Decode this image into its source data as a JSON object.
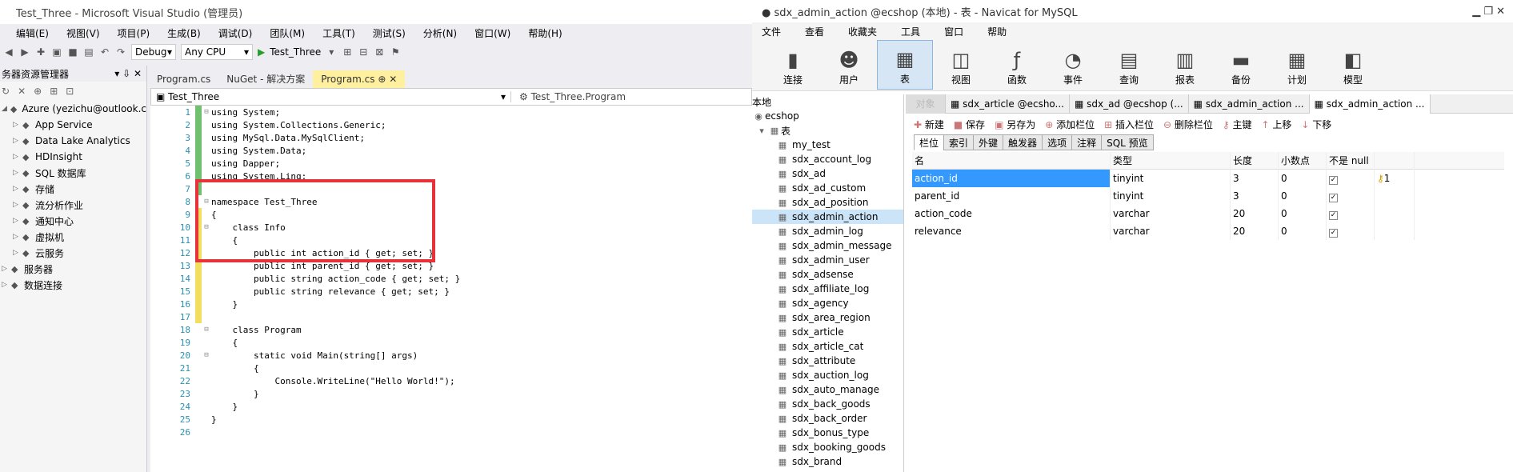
{
  "vs": {
    "title": "Test_Three - Microsoft Visual Studio (管理员)",
    "menu": [
      "编辑(E)",
      "视图(V)",
      "项目(P)",
      "生成(B)",
      "调试(D)",
      "团队(M)",
      "工具(T)",
      "测试(S)",
      "分析(N)",
      "窗口(W)",
      "帮助(H)"
    ],
    "config": "Debug",
    "platform": "Any CPU",
    "start_label": "Test_Three",
    "server_explorer": {
      "title": "务器资源管理器",
      "items": [
        {
          "label": "Azure (yezichu@outlook.c",
          "icon": "azure-icon",
          "level": 0
        },
        {
          "label": "App Service",
          "icon": "app-service-icon",
          "level": 1
        },
        {
          "label": "Data Lake Analytics",
          "icon": "data-lake-icon",
          "level": 1
        },
        {
          "label": "HDInsight",
          "icon": "hdinsight-icon",
          "level": 1
        },
        {
          "label": "SQL 数据库",
          "icon": "sql-db-icon",
          "level": 1
        },
        {
          "label": "存储",
          "icon": "storage-icon",
          "level": 1
        },
        {
          "label": "流分析作业",
          "icon": "stream-icon",
          "level": 1
        },
        {
          "label": "通知中心",
          "icon": "notification-icon",
          "level": 1
        },
        {
          "label": "虚拟机",
          "icon": "vm-icon",
          "level": 1
        },
        {
          "label": "云服务",
          "icon": "cloud-icon",
          "level": 1
        },
        {
          "label": "服务器",
          "icon": "server-icon",
          "level": 0
        },
        {
          "label": "数据连接",
          "icon": "data-connection-icon",
          "level": 0
        }
      ]
    },
    "tabs": [
      "Program.cs",
      "NuGet - 解决方案",
      "Program.cs"
    ],
    "nav_class": "Test_Three",
    "nav_member": "Test_Three.Program",
    "code": [
      {
        "n": "1",
        "t": "using System;"
      },
      {
        "n": "2",
        "t": "using System.Collections.Generic;"
      },
      {
        "n": "3",
        "t": "using MySql.Data.MySqlClient;"
      },
      {
        "n": "4",
        "t": "using System.Data;"
      },
      {
        "n": "5",
        "t": "using Dapper;"
      },
      {
        "n": "6",
        "t": "using System.Linq;"
      },
      {
        "n": "7",
        "t": ""
      },
      {
        "n": "8",
        "t": "namespace Test_Three"
      },
      {
        "n": "9",
        "t": "{"
      },
      {
        "n": "10",
        "t": "    class Info"
      },
      {
        "n": "11",
        "t": "    {"
      },
      {
        "n": "12",
        "t": "        public int action_id { get; set; }"
      },
      {
        "n": "13",
        "t": "        public int parent_id { get; set; }"
      },
      {
        "n": "14",
        "t": "        public string action_code { get; set; }"
      },
      {
        "n": "15",
        "t": "        public string relevance { get; set; }"
      },
      {
        "n": "16",
        "t": "    }"
      },
      {
        "n": "17",
        "t": ""
      },
      {
        "n": "18",
        "t": "    class Program"
      },
      {
        "n": "19",
        "t": "    {"
      },
      {
        "n": "20",
        "t": "        static void Main(string[] args)"
      },
      {
        "n": "21",
        "t": "        {"
      },
      {
        "n": "22",
        "t": "            Console.WriteLine(\"Hello World!\");"
      },
      {
        "n": "23",
        "t": "        }"
      },
      {
        "n": "24",
        "t": "    }"
      },
      {
        "n": "25",
        "t": "}"
      },
      {
        "n": "26",
        "t": ""
      }
    ]
  },
  "nv": {
    "title": "sdx_admin_action @ecshop (本地) - 表 - Navicat for MySQL",
    "menu": [
      "文件",
      "查看",
      "收藏夹",
      "工具",
      "窗口",
      "帮助"
    ],
    "toolbar": [
      {
        "label": "连接",
        "icon": "connection-icon"
      },
      {
        "label": "用户",
        "icon": "user-icon"
      },
      {
        "label": "表",
        "icon": "table-icon"
      },
      {
        "label": "视图",
        "icon": "view-icon"
      },
      {
        "label": "函数",
        "icon": "function-icon"
      },
      {
        "label": "事件",
        "icon": "event-icon"
      },
      {
        "label": "查询",
        "icon": "query-icon"
      },
      {
        "label": "报表",
        "icon": "report-icon"
      },
      {
        "label": "备份",
        "icon": "backup-icon"
      },
      {
        "label": "计划",
        "icon": "schedule-icon"
      },
      {
        "label": "模型",
        "icon": "model-icon"
      }
    ],
    "tree_root": "本地",
    "tree_db": "ecshop",
    "tree_group": "表",
    "tables": [
      "my_test",
      "sdx_account_log",
      "sdx_ad",
      "sdx_ad_custom",
      "sdx_ad_position",
      "sdx_admin_action",
      "sdx_admin_log",
      "sdx_admin_message",
      "sdx_admin_user",
      "sdx_adsense",
      "sdx_affiliate_log",
      "sdx_agency",
      "sdx_area_region",
      "sdx_article",
      "sdx_article_cat",
      "sdx_attribute",
      "sdx_auction_log",
      "sdx_auto_manage",
      "sdx_back_goods",
      "sdx_back_order",
      "sdx_bonus_type",
      "sdx_booking_goods",
      "sdx_brand"
    ],
    "obj_tabs": [
      "对象",
      "sdx_article @ecsho...",
      "sdx_ad @ecshop (...",
      "sdx_admin_action ...",
      "sdx_admin_action ..."
    ],
    "design_tools": [
      "新建",
      "保存",
      "另存为",
      "添加栏位",
      "插入栏位",
      "删除栏位",
      "主键",
      "上移",
      "下移"
    ],
    "sub_tabs": [
      "栏位",
      "索引",
      "外键",
      "触发器",
      "选项",
      "注释",
      "SQL 预览"
    ],
    "columns": [
      "名",
      "类型",
      "长度",
      "小数点",
      "不是 null",
      ""
    ],
    "rows": [
      {
        "name": "action_id",
        "type": "tinyint",
        "len": "3",
        "dec": "0",
        "key": "1"
      },
      {
        "name": "parent_id",
        "type": "tinyint",
        "len": "3",
        "dec": "0",
        "key": ""
      },
      {
        "name": "action_code",
        "type": "varchar",
        "len": "20",
        "dec": "0",
        "key": ""
      },
      {
        "name": "relevance",
        "type": "varchar",
        "len": "20",
        "dec": "0",
        "key": ""
      }
    ]
  }
}
